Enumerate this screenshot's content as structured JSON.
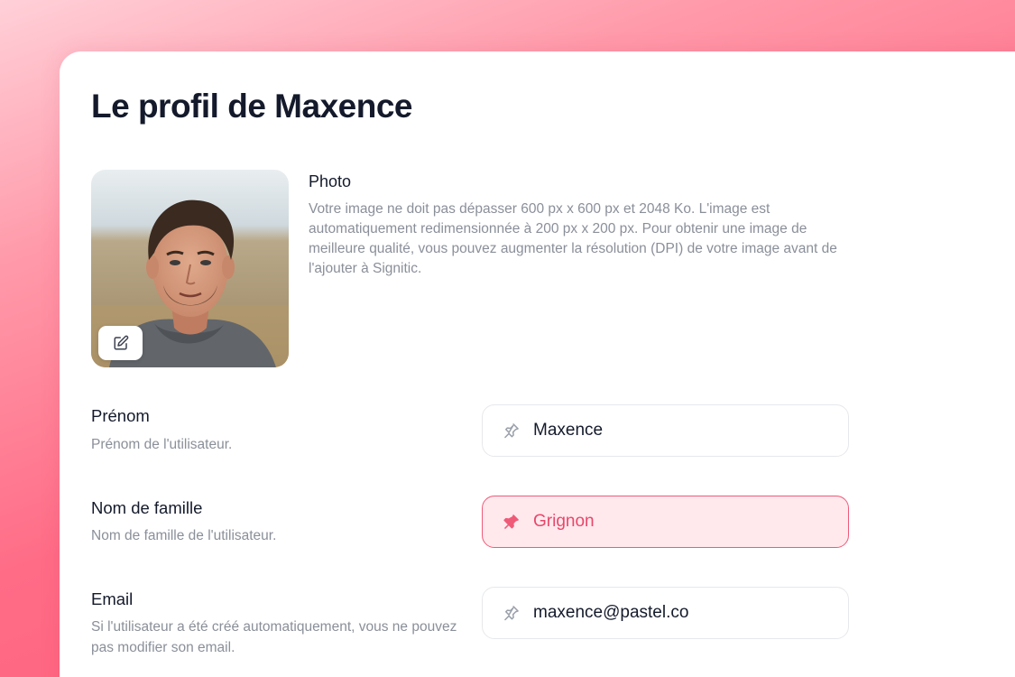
{
  "page": {
    "title": "Le profil de Maxence"
  },
  "photo": {
    "title": "Photo",
    "description": "Votre image ne doit pas dépasser 600 px x 600 px et 2048 Ko. L'image est automatiquement redimensionnée à 200 px x 200 px. Pour obtenir une image de meilleure qualité, vous pouvez augmenter la résolution (DPI) de votre image avant de l'ajouter à Signitic.",
    "edit_icon": "pencil-square-icon"
  },
  "fields": {
    "first_name": {
      "label": "Prénom",
      "help": "Prénom de l'utilisateur.",
      "value": "Maxence",
      "icon": "pin-outline-icon"
    },
    "last_name": {
      "label": "Nom de famille",
      "help": "Nom de famille de l'utilisateur.",
      "value": "Grignon",
      "icon": "pin-filled-icon"
    },
    "email": {
      "label": "Email",
      "help": "Si l'utilisateur a été créé automatiquement, vous ne pouvez pas modifier son email.",
      "value": "maxence@pastel.co",
      "icon": "pin-outline-icon"
    }
  },
  "colors": {
    "accent": "#ef5a78",
    "accent_text": "#e8476a",
    "accent_bg": "#ffe9ed",
    "title": "#141a2b",
    "muted": "#8a8f99"
  }
}
